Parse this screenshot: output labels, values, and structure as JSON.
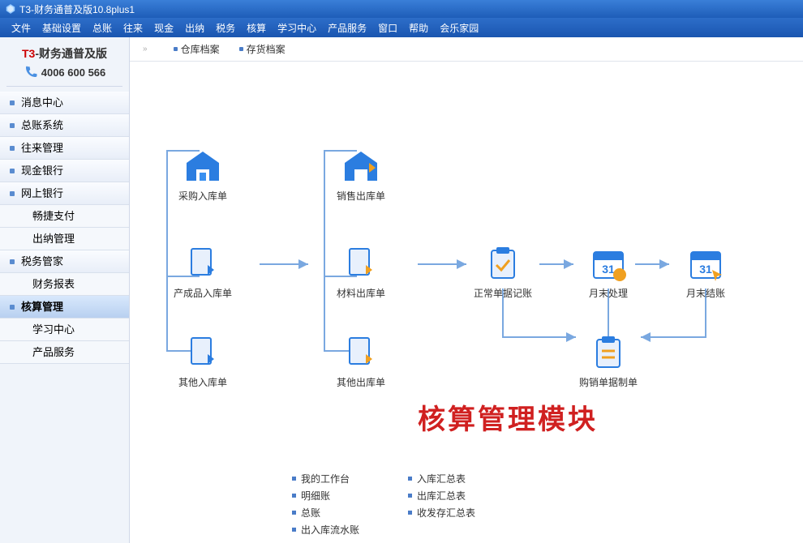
{
  "window": {
    "title": "T3-财务通普及版10.8plus1"
  },
  "menubar": [
    "文件",
    "基础设置",
    "总账",
    "往来",
    "现金",
    "出纳",
    "税务",
    "核算",
    "学习中心",
    "产品服务",
    "窗口",
    "帮助",
    "会乐家园"
  ],
  "brand": {
    "prefix": "T3",
    "suffix": "-财务通普及版",
    "phone": "4006 600 566"
  },
  "sidebar": [
    {
      "label": "消息中心",
      "sub": false,
      "active": false
    },
    {
      "label": "总账系统",
      "sub": false,
      "active": false
    },
    {
      "label": "往来管理",
      "sub": false,
      "active": false
    },
    {
      "label": "现金银行",
      "sub": false,
      "active": false
    },
    {
      "label": "网上银行",
      "sub": false,
      "active": false
    },
    {
      "label": "畅捷支付",
      "sub": true,
      "active": false
    },
    {
      "label": "出纳管理",
      "sub": true,
      "active": false
    },
    {
      "label": "税务管家",
      "sub": false,
      "active": false
    },
    {
      "label": "财务报表",
      "sub": true,
      "active": false
    },
    {
      "label": "核算管理",
      "sub": false,
      "active": true
    },
    {
      "label": "学习中心",
      "sub": true,
      "active": false
    },
    {
      "label": "产品服务",
      "sub": true,
      "active": false
    }
  ],
  "breadcrumb": [
    "仓库档案",
    "存货档案"
  ],
  "flow": {
    "col1": [
      "采购入库单",
      "产成品入库单",
      "其他入库单"
    ],
    "col2": [
      "销售出库单",
      "材料出库单",
      "其他出库单"
    ],
    "n_normal": "正常单据记账",
    "n_monthend": "月末处理",
    "n_close": "月末结账",
    "n_sales": "购销单据制单"
  },
  "big_title": "核算管理模块",
  "bottom_links": {
    "col1": [
      "我的工作台",
      "明细账",
      "总账",
      "出入库流水账"
    ],
    "col2": [
      "入库汇总表",
      "出库汇总表",
      "收发存汇总表"
    ]
  }
}
